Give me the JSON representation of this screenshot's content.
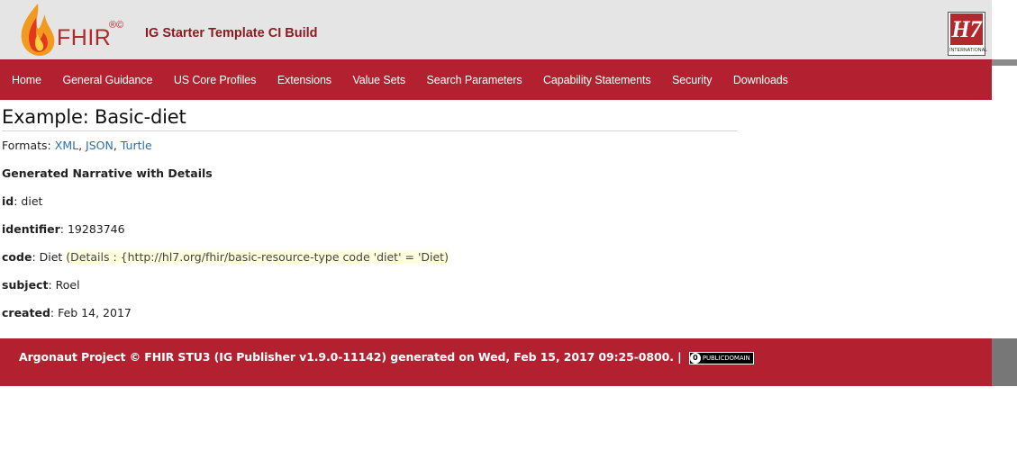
{
  "header": {
    "logo_text": "FHIR",
    "logo_marks": "®©",
    "site_title": "IG Starter Template CI Build",
    "hl7_letters": "H7",
    "hl7_intl": "INTERNATIONAL"
  },
  "nav": {
    "items": [
      {
        "label": "Home"
      },
      {
        "label": "General Guidance"
      },
      {
        "label": "US Core Profiles"
      },
      {
        "label": "Extensions"
      },
      {
        "label": "Value Sets"
      },
      {
        "label": "Search Parameters"
      },
      {
        "label": "Capability Statements"
      },
      {
        "label": "Security"
      },
      {
        "label": "Downloads"
      }
    ]
  },
  "main": {
    "title": "Example: Basic-diet",
    "formats_label": "Formats: ",
    "formats": [
      "XML",
      "JSON",
      "Turtle"
    ],
    "narrative_title": "Generated Narrative with Details",
    "fields": {
      "id": {
        "label": "id",
        "value": ": diet"
      },
      "identifier": {
        "label": "identifier",
        "value": ": 19283746"
      },
      "code": {
        "label": "code",
        "value": ": Diet ",
        "details": "(Details : {http://hl7.org/fhir/basic-resource-type code 'diet' = 'Diet)"
      },
      "subject": {
        "label": "subject",
        "value": ": Roel"
      },
      "created": {
        "label": "created",
        "value": ": Feb 14, 2017"
      }
    }
  },
  "footer": {
    "text": "Argonaut Project © FHIR STU3 (IG Publisher v1.9.0-11142) generated on Wed, Feb 15, 2017 09:25-0800. |",
    "badge_symbol": "0",
    "badge_text": "PUBLICDOMAIN"
  },
  "colors": {
    "brand_red": "#b3202f",
    "header_bg": "#e5e5e5",
    "link": "#2a6fb0",
    "details_bg": "#ffffe0"
  }
}
